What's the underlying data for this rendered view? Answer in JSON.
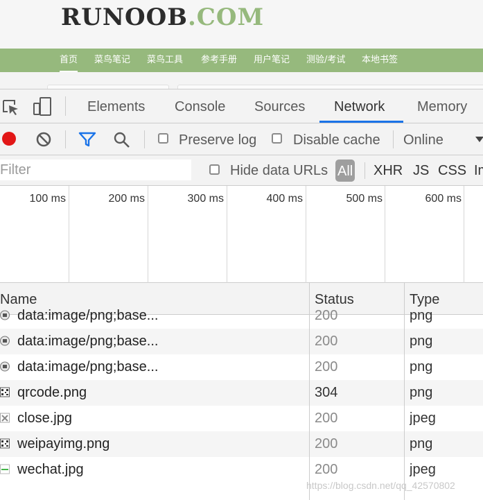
{
  "site": {
    "logo_part1": "RUNOOB",
    "logo_part2": ".COM",
    "nav": [
      "首页",
      "菜鸟笔记",
      "菜鸟工具",
      "参考手册",
      "用户笔记",
      "测验/考试",
      "本地书签"
    ],
    "brand_color": "#96b97d"
  },
  "devtools": {
    "tabs": [
      "Elements",
      "Console",
      "Sources",
      "Network",
      "Memory"
    ],
    "active_tab": "Network",
    "toolbar": {
      "preserve_log": "Preserve log",
      "disable_cache": "Disable cache",
      "throttling": "Online"
    },
    "filter": {
      "placeholder": "Filter",
      "hide_data_urls": "Hide data URLs",
      "types": [
        "All",
        "XHR",
        "JS",
        "CSS",
        "Im"
      ]
    },
    "overview": {
      "ticks": [
        "100 ms",
        "200 ms",
        "300 ms",
        "400 ms",
        "500 ms",
        "600 ms"
      ]
    },
    "table": {
      "columns": [
        "Name",
        "Status",
        "Type"
      ],
      "rows": [
        {
          "name": "data:image/png;base...",
          "status": "200",
          "type": "png",
          "icon": "image-thumb-icon"
        },
        {
          "name": "data:image/png;base...",
          "status": "200",
          "type": "png",
          "icon": "image-thumb-icon"
        },
        {
          "name": "data:image/png;base...",
          "status": "200",
          "type": "png",
          "icon": "image-thumb-icon"
        },
        {
          "name": "qrcode.png",
          "status": "304",
          "type": "png",
          "icon": "qrcode-thumb-icon"
        },
        {
          "name": "close.jpg",
          "status": "200",
          "type": "jpeg",
          "icon": "close-thumb-icon"
        },
        {
          "name": "weipayimg.png",
          "status": "200",
          "type": "png",
          "icon": "qrcode-thumb-icon"
        },
        {
          "name": "wechat.jpg",
          "status": "200",
          "type": "jpeg",
          "icon": "wechat-thumb-icon"
        }
      ]
    }
  },
  "watermark": "https://blog.csdn.net/qq_42570802",
  "colors": {
    "record": "#e21717",
    "accent": "#1a73e8",
    "filter_icon": "#1a73e8"
  }
}
